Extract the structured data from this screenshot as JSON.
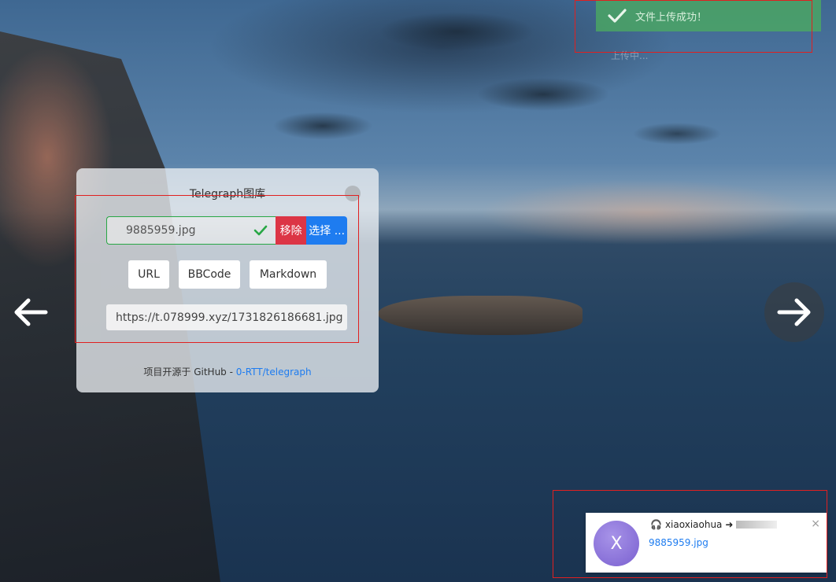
{
  "card": {
    "title": "Telegraph图库",
    "file_name": "9885959.jpg",
    "remove_label": "移除",
    "select_label": "选择 ...",
    "formats": [
      "URL",
      "BBCode",
      "Markdown"
    ],
    "result_url": "https://t.078999.xyz/1731826186681.jpg",
    "footer_text": "项目开源于 GitHub - ",
    "footer_link": "0-RTT/telegraph"
  },
  "toast": {
    "message": "文件上传成功！",
    "ghost_text": "上传中..."
  },
  "notification": {
    "avatar_letter": "X",
    "user": "xiaoxiaohua",
    "file": "9885959.jpg",
    "close_symbol": "×"
  },
  "colors": {
    "success": "#28a745",
    "danger": "#dc3545",
    "primary": "#1e7cf0",
    "annotation": "#e02020"
  }
}
